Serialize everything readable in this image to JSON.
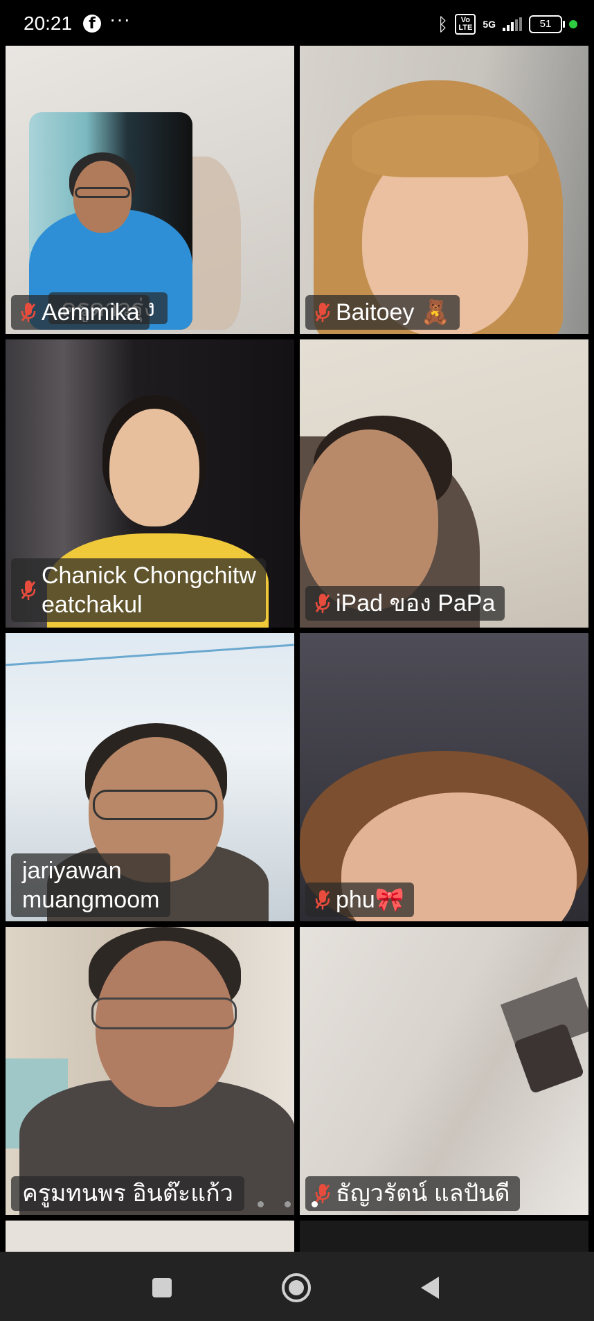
{
  "status_bar": {
    "time": "20:21",
    "facebook_glyph": "f",
    "more": "···",
    "bluetooth": "ᛒ",
    "volte": "Vo\nLTE",
    "network": "5G",
    "battery": "51",
    "indicator_color": "#2ecc40"
  },
  "self_view": {
    "label": "ครูดาวรุ่ง"
  },
  "participants": [
    {
      "name": "Aemmika",
      "muted": true
    },
    {
      "name": "Baitoey 🧸",
      "muted": true
    },
    {
      "name": "Chanick Chongchitw eatchakul",
      "line1": "Chanick Chongchitw",
      "line2": "eatchakul",
      "muted": true
    },
    {
      "name": "iPad ของ PaPa",
      "muted": true
    },
    {
      "name": "jariyawan muangmoom",
      "line1": "jariyawan",
      "line2": "muangmoom",
      "muted": false
    },
    {
      "name": "phu🎀",
      "muted": true
    },
    {
      "name": "ครูมทนพร อินต๊ะแก้ว",
      "muted": false
    },
    {
      "name": "ธัญวรัตน์ แลปันดี",
      "muted": true
    }
  ],
  "pagination": {
    "pages": 3,
    "active": 3
  },
  "nav": {
    "recents": "square-icon",
    "home": "circle-icon",
    "back": "triangle-icon"
  }
}
